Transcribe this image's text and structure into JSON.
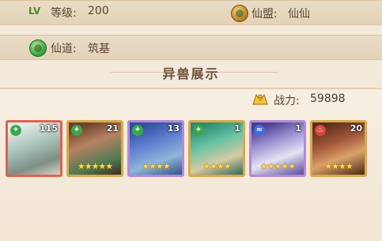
{
  "header": {
    "lv_badge": "LV",
    "level_label": "等级:",
    "level_value": "200",
    "alliance_label": "仙盟:",
    "alliance_value": "仙仙"
  },
  "path": {
    "label": "仙道:",
    "value": "筑基"
  },
  "section": {
    "title": "异兽展示",
    "power_label": "战力:",
    "power_value": "59898"
  },
  "beasts": [
    {
      "level": "115",
      "stars": "",
      "element": "green",
      "frame": "red"
    },
    {
      "level": "21",
      "stars": "★★★★★",
      "element": "green",
      "frame": "gold"
    },
    {
      "level": "13",
      "stars": "★★★★",
      "element": "green",
      "frame": "purple"
    },
    {
      "level": "1",
      "stars": "★★★★",
      "element": "green",
      "frame": "gold"
    },
    {
      "level": "1",
      "stars": "★★★★★",
      "element": "blue",
      "frame": "purple"
    },
    {
      "level": "20",
      "stars": "★★★★",
      "element": "red",
      "frame": "gold"
    }
  ],
  "colors": {
    "accent_text": "#5c4431",
    "lv_green": "#3f8d1d",
    "star_gold": "#ffd84a"
  }
}
